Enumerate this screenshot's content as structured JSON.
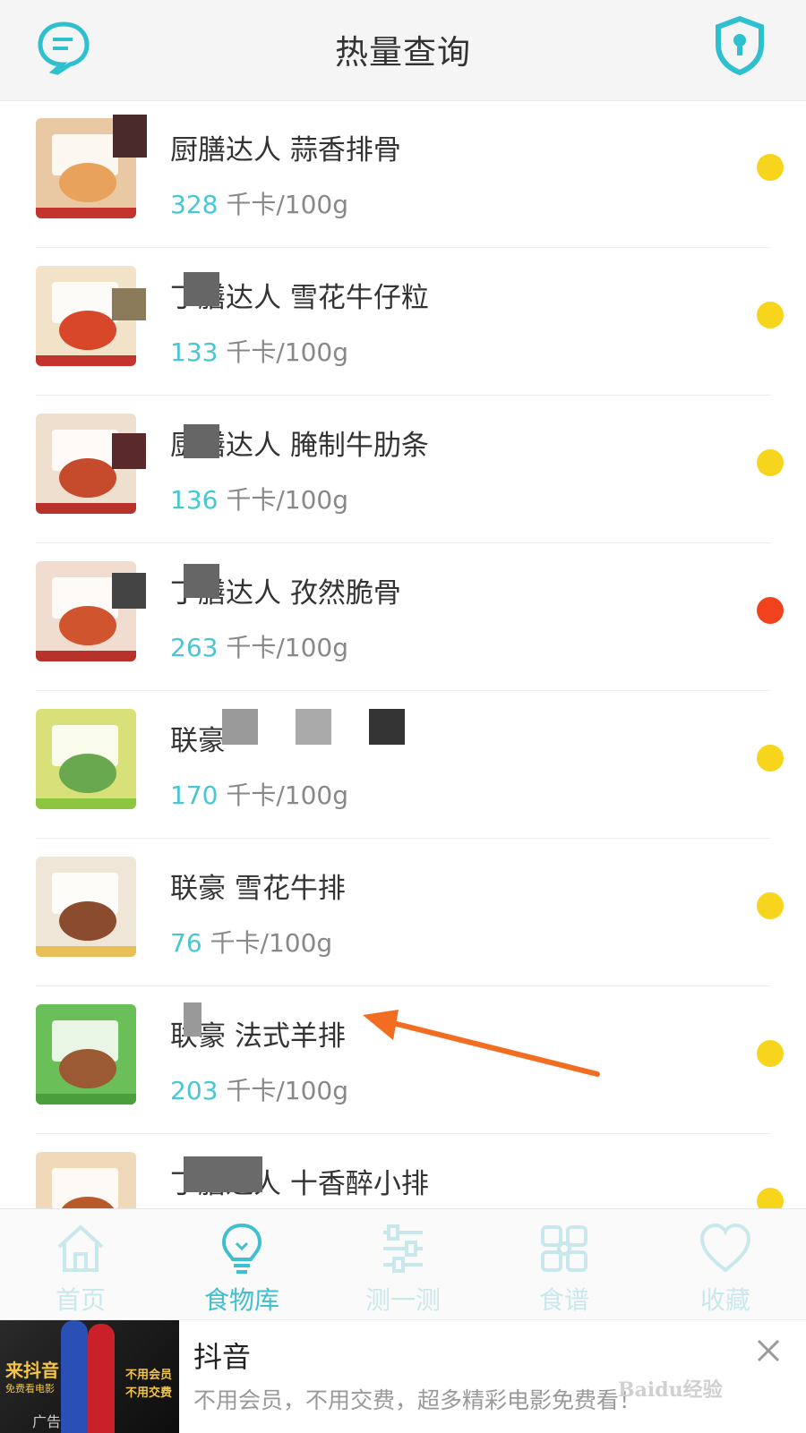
{
  "header": {
    "title": "热量查询",
    "left_icon": "chat-bubble-icon",
    "right_icon": "shield-lock-icon"
  },
  "foods": [
    {
      "name": "厨膳达人 蒜香排骨",
      "kcal": "328",
      "unit": "千卡/100g",
      "dot": "#f7d51c",
      "thumb": "#e9c9a3",
      "food": "#e8a25c",
      "strip": "#c4342f"
    },
    {
      "name": "丁膳达人 雪花牛仔粒",
      "kcal": "133",
      "unit": "千卡/100g",
      "dot": "#f7d51c",
      "thumb": "#f1e2c8",
      "food": "#d9472b",
      "strip": "#c4342f"
    },
    {
      "name": "厨膳达人 腌制牛肋条",
      "kcal": "136",
      "unit": "千卡/100g",
      "dot": "#f7d51c",
      "thumb": "#eedfcf",
      "food": "#c64a2c",
      "strip": "#b8312b"
    },
    {
      "name": "丁膳达人 孜然脆骨",
      "kcal": "263",
      "unit": "千卡/100g",
      "dot": "#f2421d",
      "thumb": "#f0ddd0",
      "food": "#d0552e",
      "strip": "#b8312b"
    },
    {
      "name": "联豪",
      "kcal": "170",
      "unit": "千卡/100g",
      "dot": "#f7d51c",
      "thumb": "#d8e07a",
      "food": "#6aa84f",
      "strip": "#8cc63f"
    },
    {
      "name": "联豪 雪花牛排",
      "kcal": "76",
      "unit": "千卡/100g",
      "dot": "#f7d51c",
      "thumb": "#efe6d8",
      "food": "#8a4b2e",
      "strip": "#e7c05a"
    },
    {
      "name": "联豪 法式羊排",
      "kcal": "203",
      "unit": "千卡/100g",
      "dot": "#f7d51c",
      "thumb": "#6bbf59",
      "food": "#9b5a33",
      "strip": "#4a9e3b"
    },
    {
      "name": "丁膳达人 十香醉小排",
      "kcal": "",
      "unit": "",
      "dot": "#f7d51c",
      "thumb": "#efd9b9",
      "food": "#b85a2c",
      "strip": "#c4342f"
    }
  ],
  "nav": [
    {
      "label": "首页",
      "icon": "home-icon",
      "active": false
    },
    {
      "label": "食物库",
      "icon": "lightbulb-icon",
      "active": true
    },
    {
      "label": "测一测",
      "icon": "sliders-icon",
      "active": false
    },
    {
      "label": "食谱",
      "icon": "grid-icon",
      "active": false
    },
    {
      "label": "收藏",
      "icon": "heart-icon",
      "active": false
    }
  ],
  "ad": {
    "image_left_1": "来抖音",
    "image_left_2": "免费看电影",
    "image_right_1": "不用会员",
    "image_right_2": "不用交费",
    "image_tag": "广告",
    "title": "抖音",
    "desc": "不用会员，不用交费，超多精彩电影免费看！",
    "watermark": "Baidu经验",
    "close_icon": "close-icon"
  },
  "colors": {
    "accent": "#3fbfd0",
    "kcal": "#49c6d1",
    "arrow": "#f26d21"
  }
}
